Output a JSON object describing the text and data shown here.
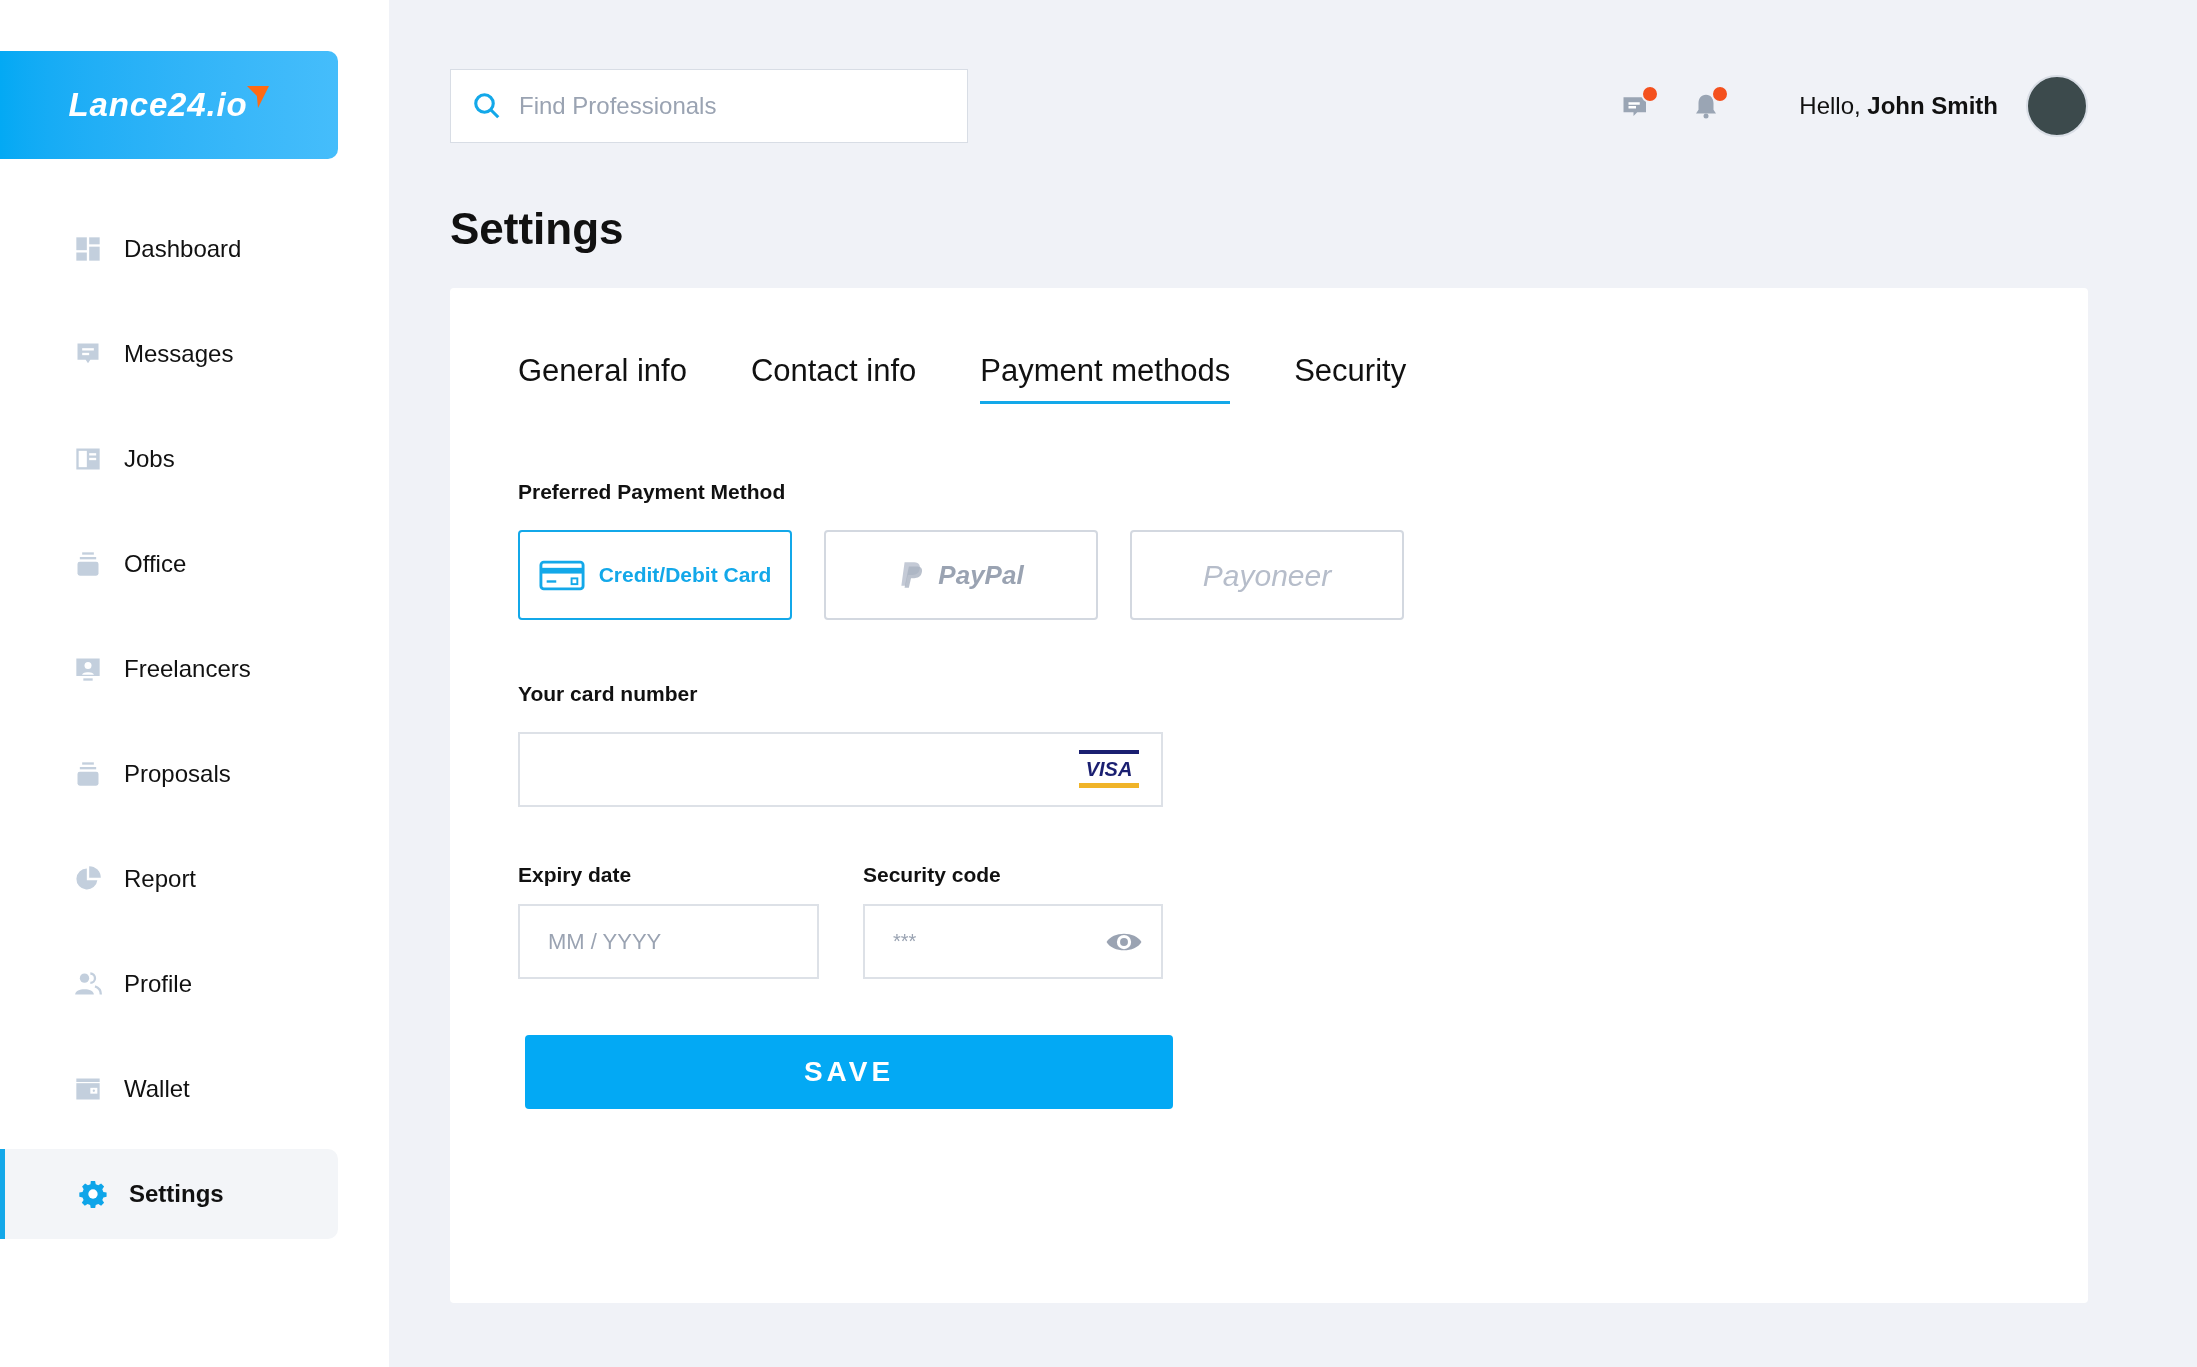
{
  "logo": {
    "text": "Lance24.io"
  },
  "sidebar": {
    "items": [
      {
        "label": "Dashboard",
        "kind": "dashboard",
        "selected": false
      },
      {
        "label": "Messages",
        "kind": "messages",
        "selected": false
      },
      {
        "label": "Jobs",
        "kind": "jobs",
        "selected": false
      },
      {
        "label": "Office",
        "kind": "office",
        "selected": false
      },
      {
        "label": "Freelancers",
        "kind": "freelancers",
        "selected": false
      },
      {
        "label": "Proposals",
        "kind": "proposals",
        "selected": false
      },
      {
        "label": "Report",
        "kind": "report",
        "selected": false
      },
      {
        "label": "Profile",
        "kind": "profile",
        "selected": false
      },
      {
        "label": "Wallet",
        "kind": "wallet",
        "selected": false
      },
      {
        "label": "Settings",
        "kind": "settings",
        "selected": true
      }
    ]
  },
  "header": {
    "search": {
      "placeholder": "Find Professionals"
    },
    "icons": [
      {
        "kind": "messages",
        "unread": true
      },
      {
        "kind": "bell",
        "unread": true
      }
    ],
    "greeting": "Hello, **John Smith**"
  },
  "page_title": "Settings",
  "tabs": [
    {
      "label": "General info",
      "selected": false
    },
    {
      "label": "Contact info",
      "selected": false
    },
    {
      "label": "Payment methods",
      "selected": true
    },
    {
      "label": "Security",
      "selected": false
    }
  ],
  "payment": {
    "label": "Preferred Payment Method",
    "methods": [
      {
        "kind": "card",
        "label": "Credit/Debit Card",
        "selected": true
      },
      {
        "kind": "paypal",
        "label": "PayPal",
        "selected": false
      },
      {
        "kind": "payoneer",
        "label": "Payoneer",
        "selected": false
      }
    ]
  },
  "card_number": {
    "label": "Your card number",
    "card_brand": "VISA"
  },
  "expiry": {
    "label": "Expiry date",
    "placeholder": "MM / YYYY"
  },
  "security_code": {
    "label": "Security code",
    "placeholder": "***"
  },
  "save_button": "SAVE"
}
